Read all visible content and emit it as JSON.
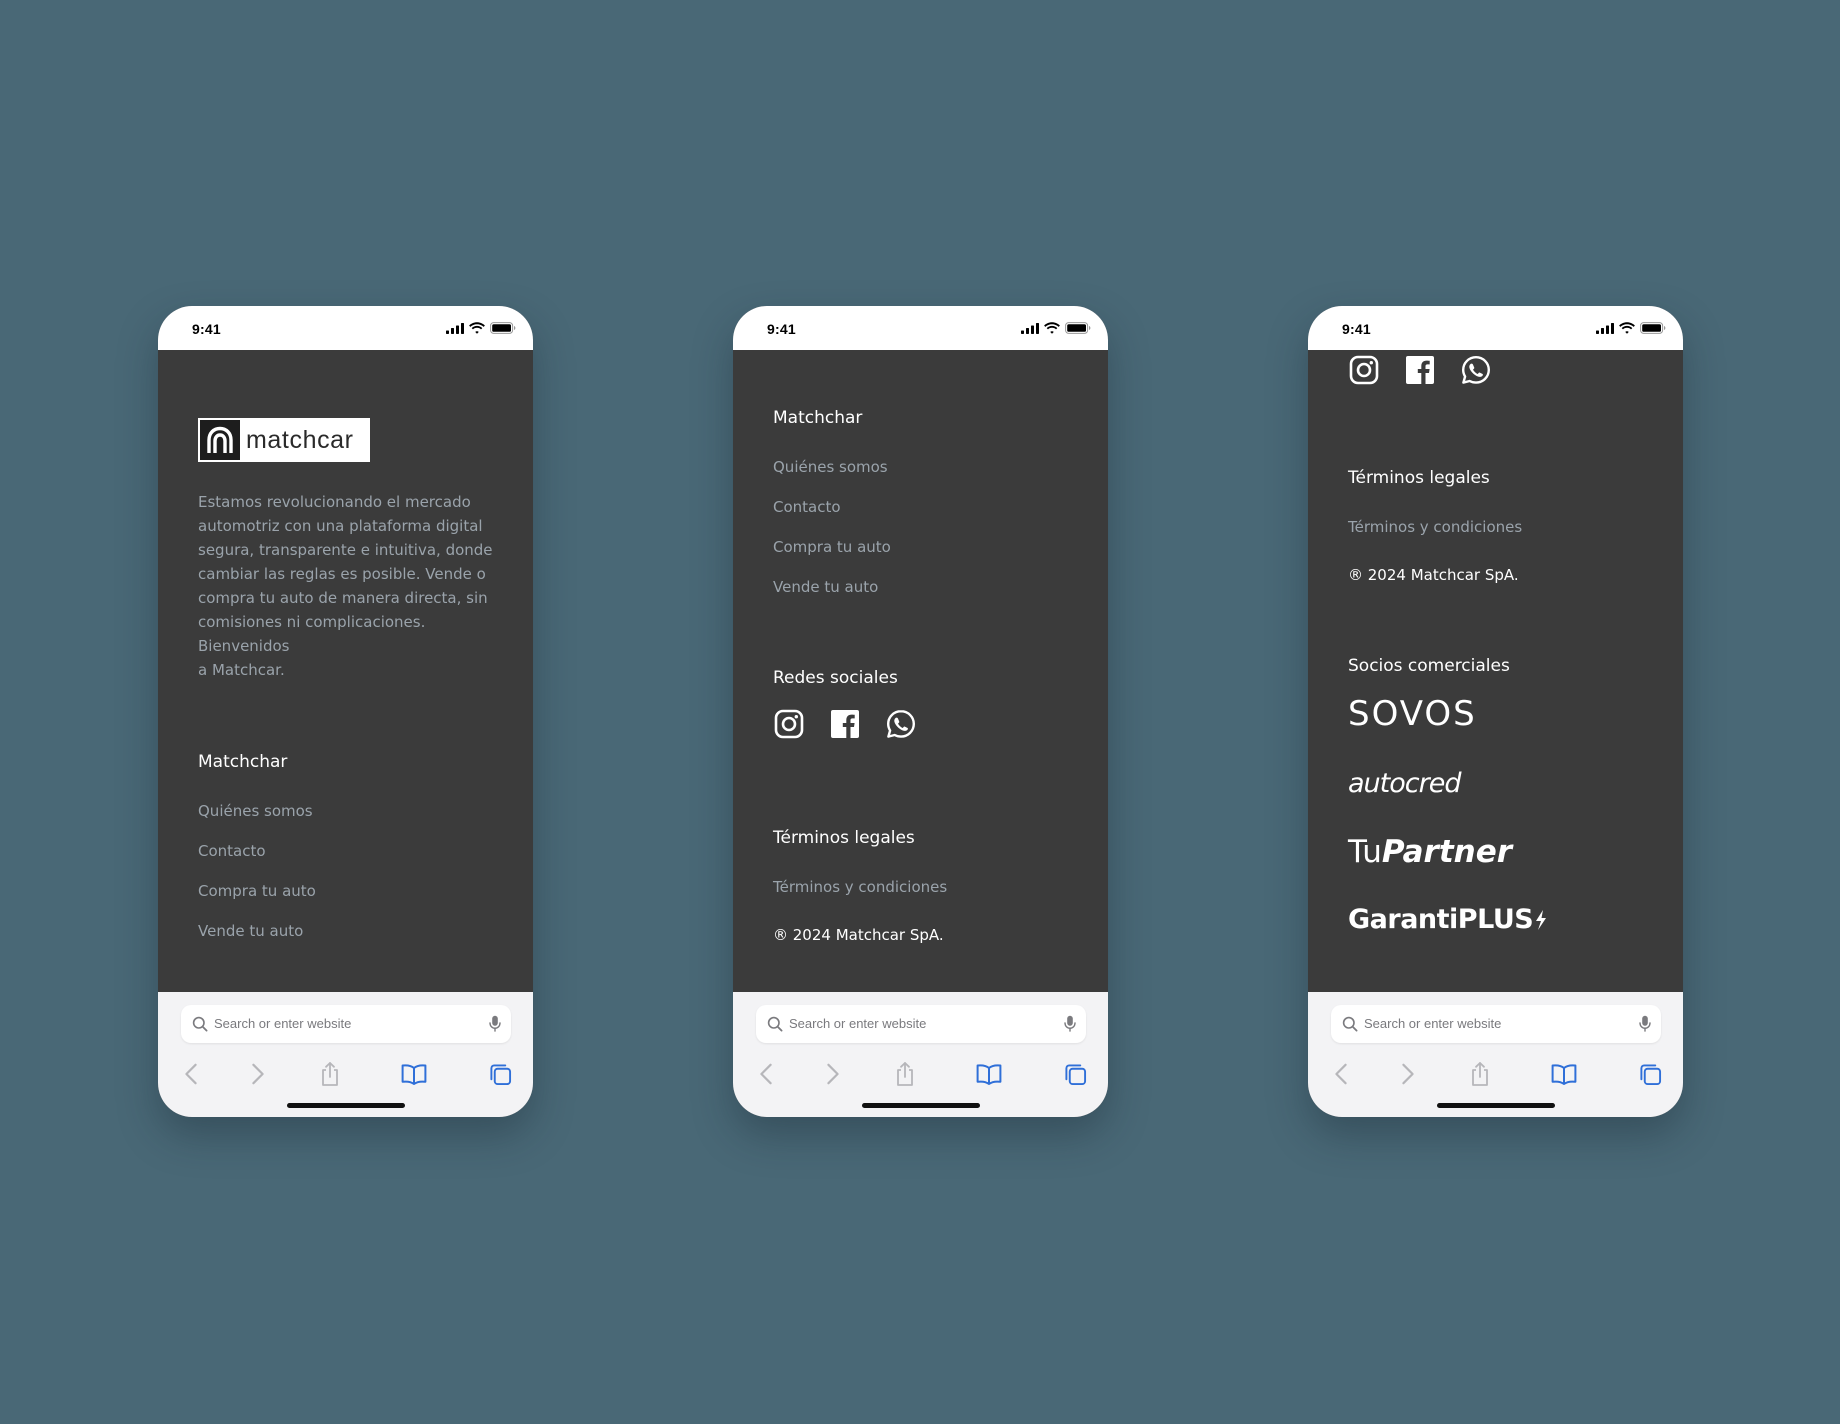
{
  "colors": {
    "background": "#496876",
    "footer_bg": "#3b3b3b",
    "link_text": "#9aa3ab",
    "heading_text": "#ffffff",
    "browser_accent": "#2f6fd8"
  },
  "status_bar": {
    "time": "9:41"
  },
  "browser": {
    "search_placeholder": "Search or enter website",
    "icons": [
      "back-icon",
      "forward-icon",
      "share-icon",
      "bookmarks-icon",
      "tabs-icon"
    ]
  },
  "screen1": {
    "logo_text": "matchcar",
    "intro": "Estamos revolucionando el mercado automotriz con una plataforma digital segura, transparente e intuitiva, donde cambiar las reglas es posible. Vende o compra tu auto de manera directa, sin comisiones ni complicaciones. Bienvenidos",
    "intro_line2": "a Matchcar.",
    "section_title": "Matchchar",
    "links": [
      "Quiénes somos",
      "Contacto",
      "Compra tu auto",
      "Vende tu auto"
    ]
  },
  "screen2": {
    "section_title": "Matchchar",
    "links": [
      "Quiénes somos",
      "Contacto",
      "Compra tu auto",
      "Vende tu auto"
    ],
    "social_title": "Redes sociales",
    "social_icons": [
      "instagram-icon",
      "facebook-icon",
      "whatsapp-icon"
    ],
    "legal_title": "Términos legales",
    "legal_link": "Términos y condiciones",
    "copyright": "® 2024 Matchcar SpA."
  },
  "screen3": {
    "social_icons": [
      "instagram-icon",
      "facebook-icon",
      "whatsapp-icon"
    ],
    "legal_title": "Términos legales",
    "legal_link": "Términos y condiciones",
    "copyright": "® 2024 Matchcar SpA.",
    "partners_title": "Socios comerciales",
    "partners": {
      "sovos": "SOVOS",
      "autocred": "autocred",
      "tupartner_light": "Tu",
      "tupartner_bold": "Partner",
      "garanti": "GarantiPLUS"
    }
  }
}
